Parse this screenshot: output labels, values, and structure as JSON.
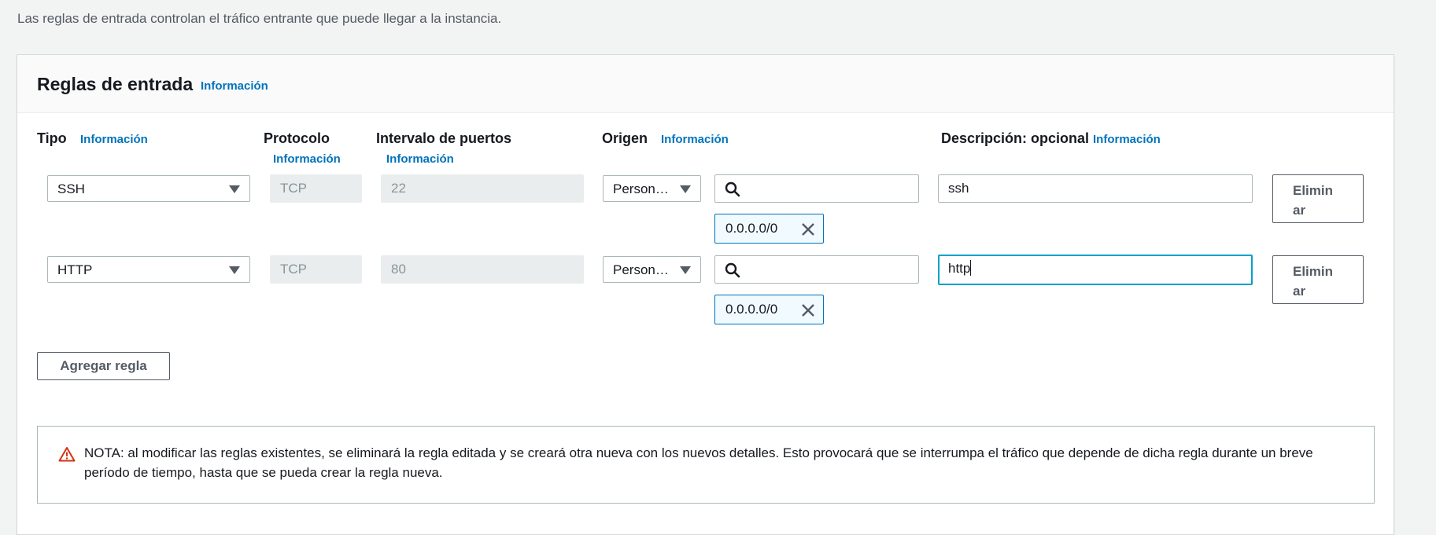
{
  "intro_text": "Las reglas de entrada controlan el tráfico entrante que puede llegar a la instancia.",
  "panel": {
    "title": "Reglas de entrada",
    "info_link": "Información"
  },
  "columns": {
    "tipo": {
      "label": "Tipo",
      "info": "Información"
    },
    "protocolo": {
      "label": "Protocolo",
      "info": "Información"
    },
    "puertos": {
      "label": "Intervalo de puertos",
      "info": "Información"
    },
    "origen": {
      "label": "Origen",
      "info": "Información"
    },
    "descripcion": {
      "label": "Descripción: opcional",
      "info": "Información"
    }
  },
  "rules": [
    {
      "type": "SSH",
      "protocol": "TCP",
      "port_range": "22",
      "source_type": "Person…",
      "search_value": "",
      "cidr_token": "0.0.0.0/0",
      "description": "ssh",
      "remove_label_1": "Elimin",
      "remove_label_2": "ar"
    },
    {
      "type": "HTTP",
      "protocol": "TCP",
      "port_range": "80",
      "source_type": "Person…",
      "search_value": "",
      "cidr_token": "0.0.0.0/0",
      "description": "http",
      "remove_label_1": "Elimin",
      "remove_label_2": "ar"
    }
  ],
  "add_rule_label": "Agregar regla",
  "alert": {
    "icon": "warning-triangle-icon",
    "text": "NOTA: al modificar las reglas existentes, se eliminará la regla editada y se creará otra nueva con los nuevos detalles. Esto provocará que se interrumpa el tráfico que depende de dicha regla durante un breve período de tiempo, hasta que se pueda crear la regla nueva."
  },
  "colors": {
    "link": "#0073bb",
    "focus": "#00a1c9",
    "warning": "#d13212"
  }
}
